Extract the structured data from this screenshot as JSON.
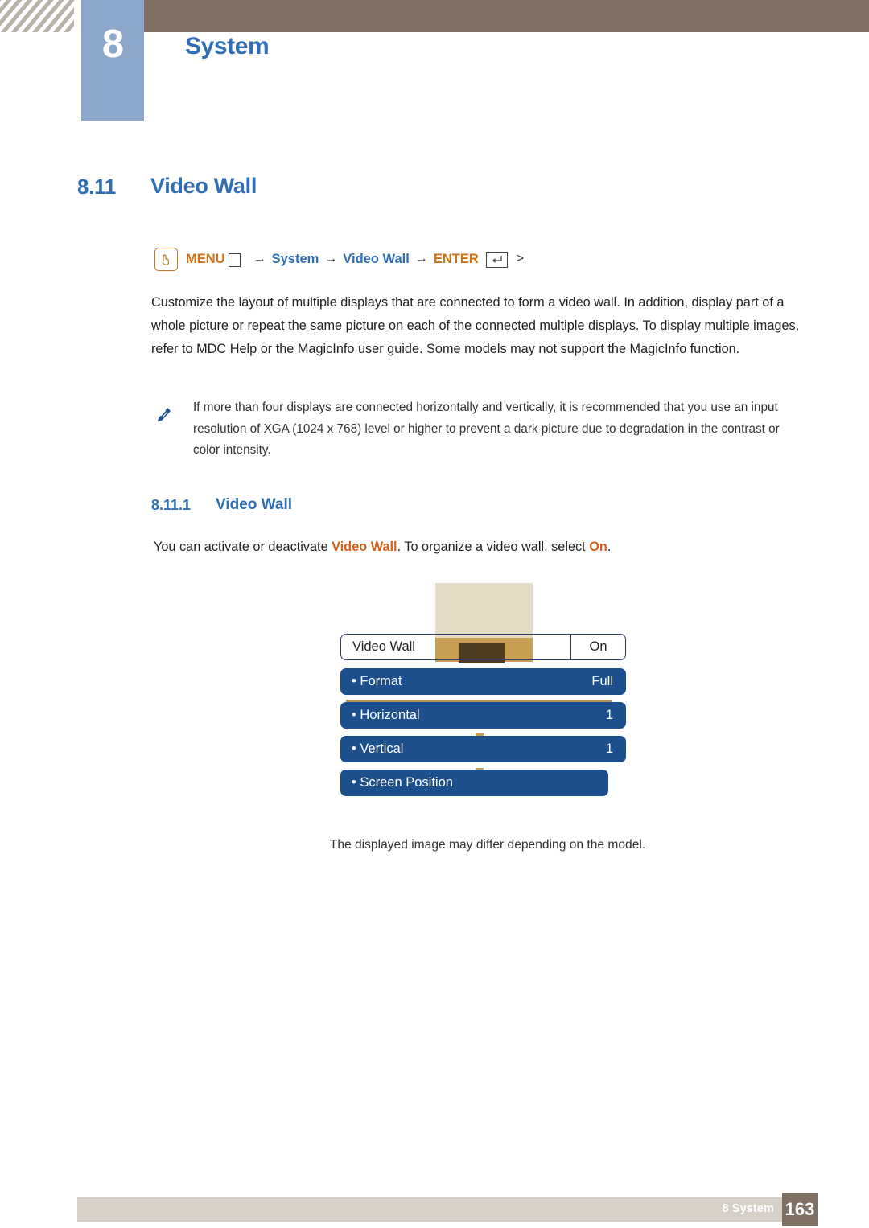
{
  "header": {
    "chapter_number": "8",
    "chapter_title": "System"
  },
  "section": {
    "number": "8.11",
    "title": "Video Wall"
  },
  "menu_path": {
    "menu_label": "MENU",
    "arrow1": "→",
    "system_label": "System",
    "arrow2": "→",
    "video_wall_label": "Video Wall",
    "arrow3": "→",
    "enter_label": "ENTER",
    "enter_key_glyph": "↵",
    "trailing": ">"
  },
  "body": {
    "paragraph": "Customize the layout of multiple displays that are connected to form a video wall. In addition, display part of a whole picture or repeat the same picture on each of the connected multiple displays. To display multiple images, refer to MDC Help or the MagicInfo user guide. Some models may not support the MagicInfo function."
  },
  "note": {
    "text": "If more than four displays are connected horizontally and vertically, it is recommended that you use an input resolution of XGA (1024 x 768) level or higher to prevent a dark picture due to degradation in the contrast or color intensity."
  },
  "subsection": {
    "number": "8.11.1",
    "title": "Video Wall",
    "text_before": "You can activate or deactivate ",
    "highlight1": "Video Wall",
    "text_middle": ". To organize a video wall, select ",
    "highlight2": "On",
    "text_after": "."
  },
  "osd": {
    "header_row": {
      "label": "Video Wall",
      "value": "On"
    },
    "rows": [
      {
        "label": "• Format",
        "value": "Full"
      },
      {
        "label": "• Horizontal",
        "value": "1"
      },
      {
        "label": "• Vertical",
        "value": "1"
      },
      {
        "label": "• Screen Position",
        "value": ""
      }
    ],
    "caption": "The displayed image may differ depending on the model."
  },
  "footer": {
    "label": "8 System",
    "page": "163"
  },
  "colors": {
    "header_brown": "#7e7163",
    "chapter_blue": "#8da6cc",
    "heading_blue": "#2f6eb5",
    "orange": "#d07218",
    "highlight_orange": "#d4601a",
    "osd_blue": "#1d4f8c",
    "footer_grey": "#d7d0c7"
  }
}
